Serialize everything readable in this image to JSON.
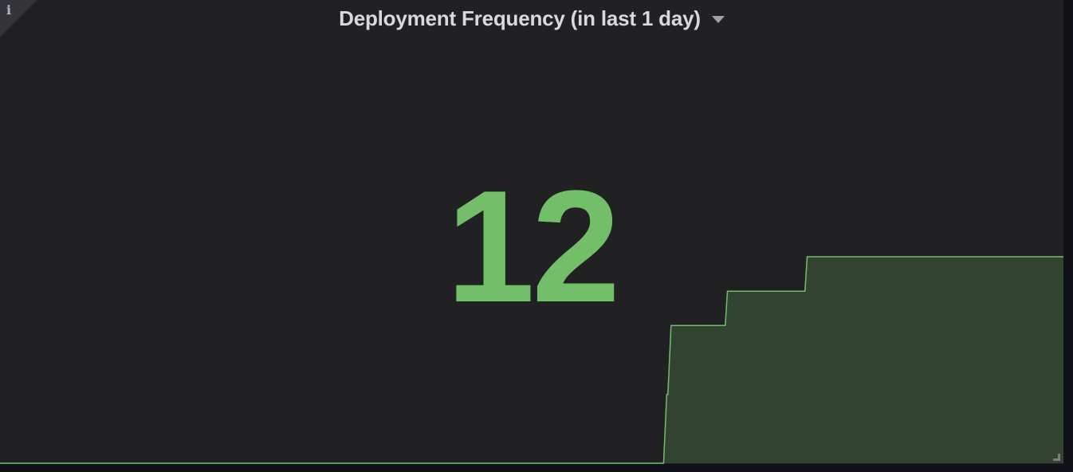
{
  "panel": {
    "title": "Deployment Frequency (in last 1 day)",
    "value": "12",
    "info_icon_glyph": "i",
    "title_menu_icon": "caret-down-icon",
    "info_icon": "info-icon",
    "resize_icon": "resize-handle-icon"
  },
  "colors": {
    "background": "#111217",
    "panel_bg": "#212124",
    "value": "#73bf69",
    "sparkline_line": "#73bf69",
    "sparkline_fill": "#324332",
    "title": "#d8d9de"
  },
  "chart_data": {
    "type": "area",
    "title": "",
    "xlabel": "",
    "ylabel": "",
    "x_fraction": [
      0,
      0.624,
      0.627,
      0.628,
      0.631,
      0.682,
      0.684,
      0.757,
      0.759,
      1.0
    ],
    "y": [
      0,
      0,
      2,
      2,
      4,
      4,
      5,
      5,
      6,
      6
    ],
    "ylim": [
      0,
      12
    ],
    "grid": false,
    "legend": "none"
  }
}
